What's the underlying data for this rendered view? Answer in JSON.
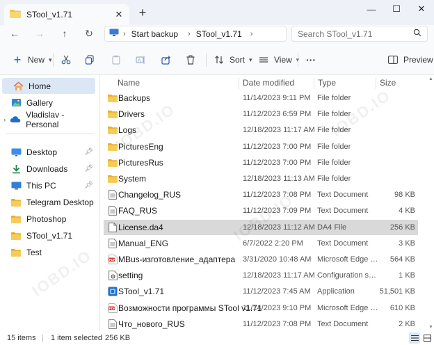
{
  "tab": {
    "title": "STool_v1.71",
    "close": "✕",
    "new_tab": "+"
  },
  "window_controls": {
    "minimize": "—",
    "maximize": "☐",
    "close": "✕"
  },
  "nav": {
    "back": "←",
    "forward": "→",
    "up": "↑",
    "refresh": "↻",
    "breadcrumbs": [
      "Start backup",
      "STool_v1.71"
    ],
    "search_placeholder": "Search STool_v1.71"
  },
  "toolbar": {
    "new_label": "New",
    "sort_label": "Sort",
    "view_label": "View",
    "more": "···",
    "preview_label": "Preview"
  },
  "sidebar": {
    "items": [
      {
        "label": "Home",
        "icon": "home-icon",
        "selected": true
      },
      {
        "label": "Gallery",
        "icon": "gallery-icon"
      },
      {
        "label": "Vladislav - Personal",
        "icon": "cloud-icon",
        "expandable": true
      },
      {
        "label": "Desktop",
        "icon": "desktop-icon",
        "pinned": true
      },
      {
        "label": "Downloads",
        "icon": "downloads-icon",
        "pinned": true
      },
      {
        "label": "This PC",
        "icon": "pc-icon",
        "pinned": true
      },
      {
        "label": "Telegram Desktop",
        "icon": "folder-icon"
      },
      {
        "label": "Photoshop",
        "icon": "folder-icon"
      },
      {
        "label": "STool_v1.71",
        "icon": "folder-icon"
      },
      {
        "label": "Test",
        "icon": "folder-icon"
      }
    ]
  },
  "columns": {
    "name": "Name",
    "date": "Date modified",
    "type": "Type",
    "size": "Size"
  },
  "files": [
    {
      "name": "Backups",
      "date": "11/14/2023 9:11 PM",
      "type": "File folder",
      "size": "",
      "icon": "folder"
    },
    {
      "name": "Drivers",
      "date": "11/12/2023 6:59 PM",
      "type": "File folder",
      "size": "",
      "icon": "folder"
    },
    {
      "name": "Logs",
      "date": "12/18/2023 11:17 AM",
      "type": "File folder",
      "size": "",
      "icon": "folder"
    },
    {
      "name": "PicturesEng",
      "date": "11/12/2023 7:00 PM",
      "type": "File folder",
      "size": "",
      "icon": "folder"
    },
    {
      "name": "PicturesRus",
      "date": "11/12/2023 7:00 PM",
      "type": "File folder",
      "size": "",
      "icon": "folder"
    },
    {
      "name": "System",
      "date": "12/18/2023 11:13 AM",
      "type": "File folder",
      "size": "",
      "icon": "folder"
    },
    {
      "name": "Changelog_RUS",
      "date": "11/12/2023 7:08 PM",
      "type": "Text Document",
      "size": "98 KB",
      "icon": "doc"
    },
    {
      "name": "FAQ_RUS",
      "date": "11/12/2023 7:09 PM",
      "type": "Text Document",
      "size": "4 KB",
      "icon": "doc"
    },
    {
      "name": "License.da4",
      "date": "12/18/2023 11:12 AM",
      "type": "DA4 File",
      "size": "256 KB",
      "icon": "blank",
      "selected": true
    },
    {
      "name": "Manual_ENG",
      "date": "6/7/2022 2:20 PM",
      "type": "Text Document",
      "size": "3 KB",
      "icon": "doc"
    },
    {
      "name": "MBus-изготовление_адаптера",
      "date": "3/31/2020 10:48 AM",
      "type": "Microsoft Edge P...",
      "size": "564 KB",
      "icon": "pdf"
    },
    {
      "name": "setting",
      "date": "12/18/2023 11:17 AM",
      "type": "Configuration sett...",
      "size": "1 KB",
      "icon": "settings"
    },
    {
      "name": "STool_v1.71",
      "date": "11/12/2023 7:45 AM",
      "type": "Application",
      "size": "51,501 KB",
      "icon": "app"
    },
    {
      "name": "Возможности программы STool v1.71",
      "date": "11/14/2023 9:10 PM",
      "type": "Microsoft Edge P...",
      "size": "610 KB",
      "icon": "pdf"
    },
    {
      "name": "Что_нового_RUS",
      "date": "11/12/2023 7:08 PM",
      "type": "Text Document",
      "size": "2 KB",
      "icon": "doc"
    }
  ],
  "status": {
    "items": "15 items",
    "selected": "1 item selected",
    "size": "256 KB"
  },
  "watermark": "IOBD.IO",
  "colors": {
    "folder": "#f4c247",
    "accent": "#0a64c8",
    "pdf": "#d8362a",
    "selected_row": "#d9d9d9"
  }
}
